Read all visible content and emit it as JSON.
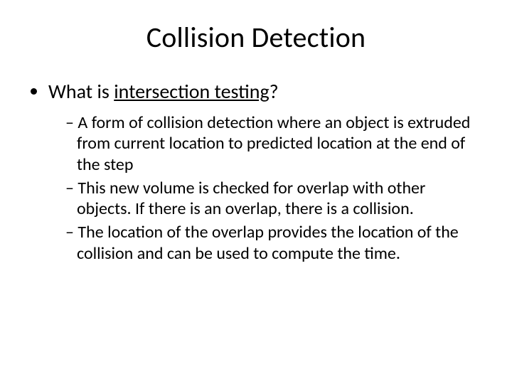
{
  "slide": {
    "title": "Collision Detection",
    "question_prefix": "What is ",
    "question_term": "intersection testing",
    "question_suffix": "?",
    "bullets": [
      "A form of collision detection where an object is extruded from current location to predicted location at the end of the step",
      "This new volume is checked for overlap with other objects.  If there is an overlap, there is a collision.",
      "The location of the overlap provides the location of the collision and can be used to compute the time."
    ]
  }
}
